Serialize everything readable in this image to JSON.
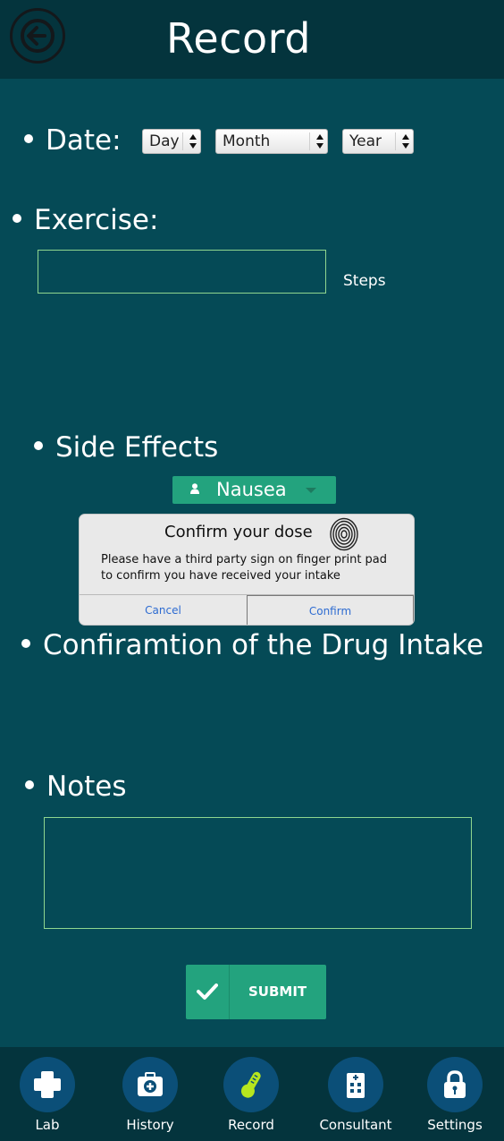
{
  "header": {
    "title": "Record"
  },
  "date": {
    "label": "Date:",
    "day": "Day",
    "month": "Month",
    "year": "Year"
  },
  "exercise": {
    "label": "Exercise:",
    "unit": "Steps"
  },
  "side_effects": {
    "label": "Side Effects",
    "selected": "Nausea"
  },
  "dialog": {
    "title": "Confirm your dose",
    "message": "Please have a third party sign on finger print pad to confirm you have received your intake",
    "cancel": "Cancel",
    "confirm": "Confirm"
  },
  "confirmation": {
    "label": "Confiramtion of the Drug Intake"
  },
  "notes": {
    "label": "Notes"
  },
  "submit": {
    "label": "SUBMIT"
  },
  "tabs": [
    {
      "label": "Lab",
      "icon": "medical-cross-icon"
    },
    {
      "label": "History",
      "icon": "medical-kit-icon"
    },
    {
      "label": "Record",
      "icon": "thermometer-icon"
    },
    {
      "label": "Consultant",
      "icon": "hospital-icon"
    },
    {
      "label": "Settings",
      "icon": "lock-icon"
    }
  ],
  "colors": {
    "background": "#054a56",
    "header": "#04343d",
    "accent": "#23a37e",
    "tab_circle": "#0b4f78"
  }
}
